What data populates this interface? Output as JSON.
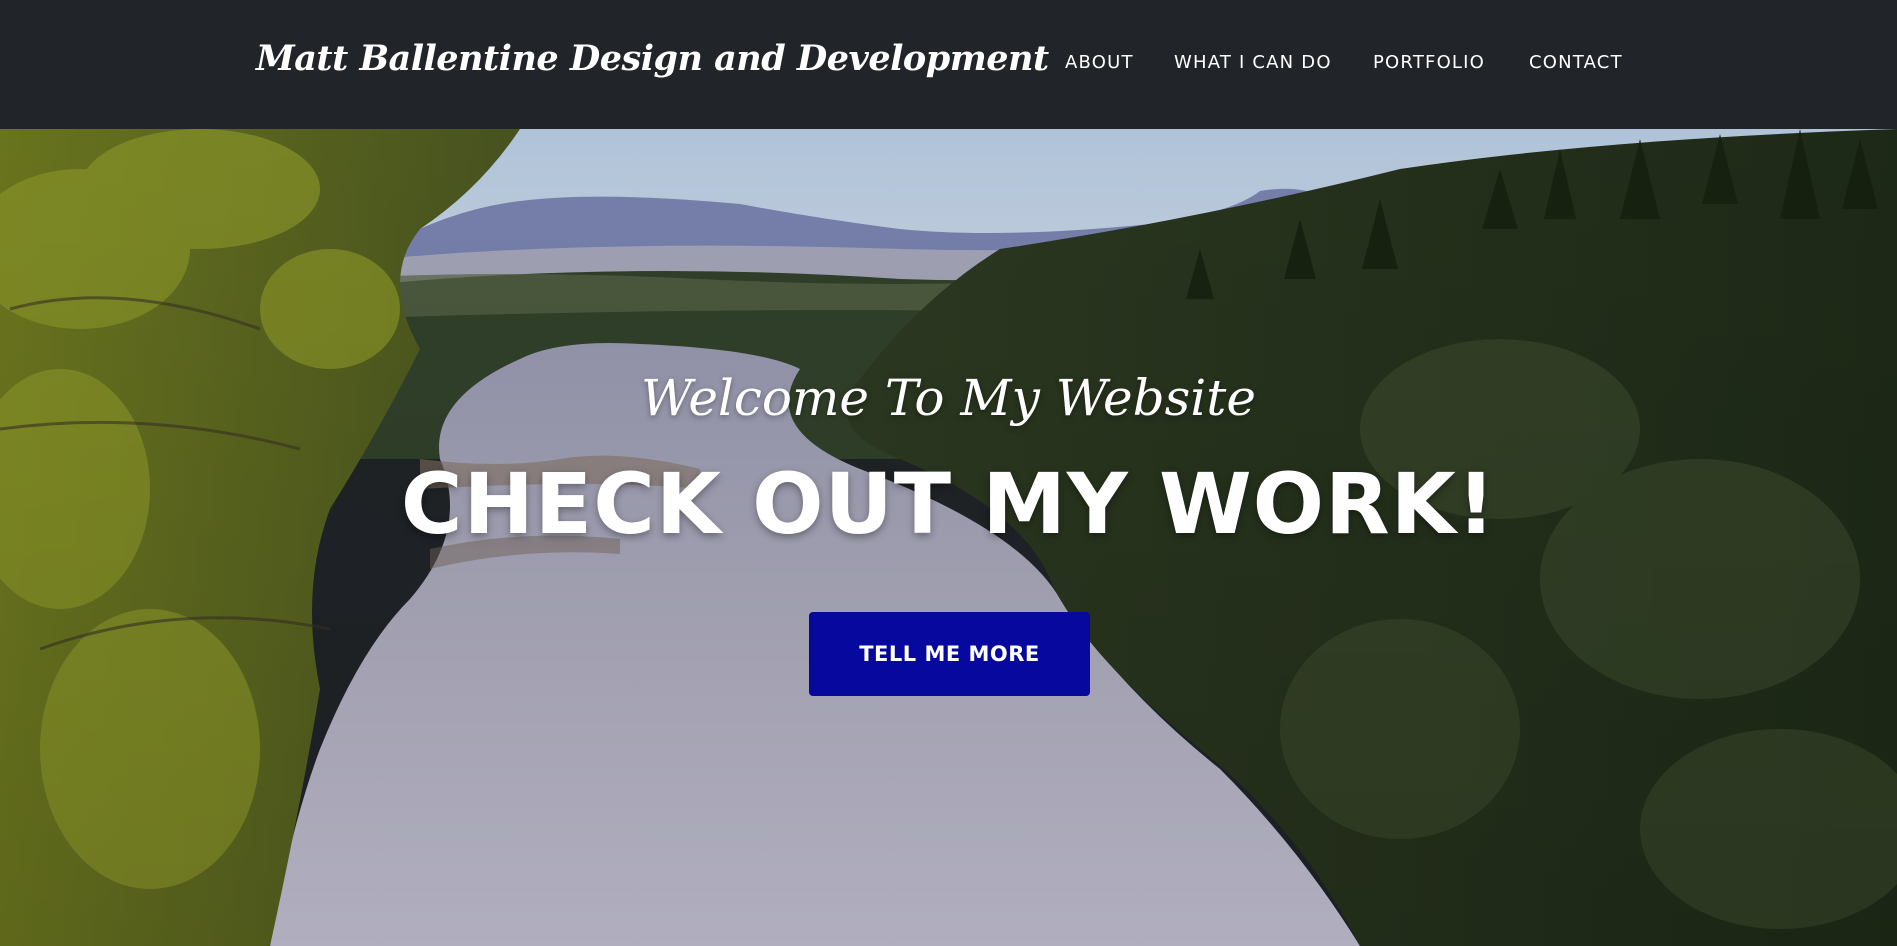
{
  "navbar": {
    "brand": "Matt Ballentine Design and Development",
    "links": [
      {
        "label": "ABOUT"
      },
      {
        "label": "WHAT I CAN DO"
      },
      {
        "label": "PORTFOLIO"
      },
      {
        "label": "CONTACT"
      }
    ]
  },
  "hero": {
    "subheading": "Welcome To My Website",
    "heading": "CHECK OUT MY WORK!",
    "button_label": "TELL ME MORE",
    "background": "photo of a river valley with pine forest and distant hills",
    "button_color": "#06089e",
    "navbar_color": "#212529"
  }
}
